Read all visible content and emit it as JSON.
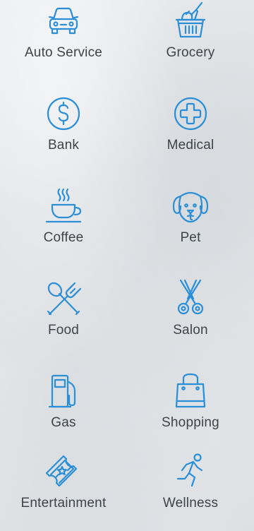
{
  "categories": [
    {
      "label": "Auto Service",
      "icon": "car-icon"
    },
    {
      "label": "Grocery",
      "icon": "grocery-basket-icon"
    },
    {
      "label": "Bank",
      "icon": "dollar-icon"
    },
    {
      "label": "Medical",
      "icon": "medical-cross-icon"
    },
    {
      "label": "Coffee",
      "icon": "coffee-cup-icon"
    },
    {
      "label": "Pet",
      "icon": "dog-icon"
    },
    {
      "label": "Food",
      "icon": "fork-spoon-icon"
    },
    {
      "label": "Salon",
      "icon": "scissors-icon"
    },
    {
      "label": "Gas",
      "icon": "gas-pump-icon"
    },
    {
      "label": "Shopping",
      "icon": "shopping-bag-icon"
    },
    {
      "label": "Entertainment",
      "icon": "ticket-icon"
    },
    {
      "label": "Wellness",
      "icon": "runner-icon"
    }
  ],
  "colors": {
    "icon": "#2b8fd8",
    "label": "#3f4449"
  }
}
